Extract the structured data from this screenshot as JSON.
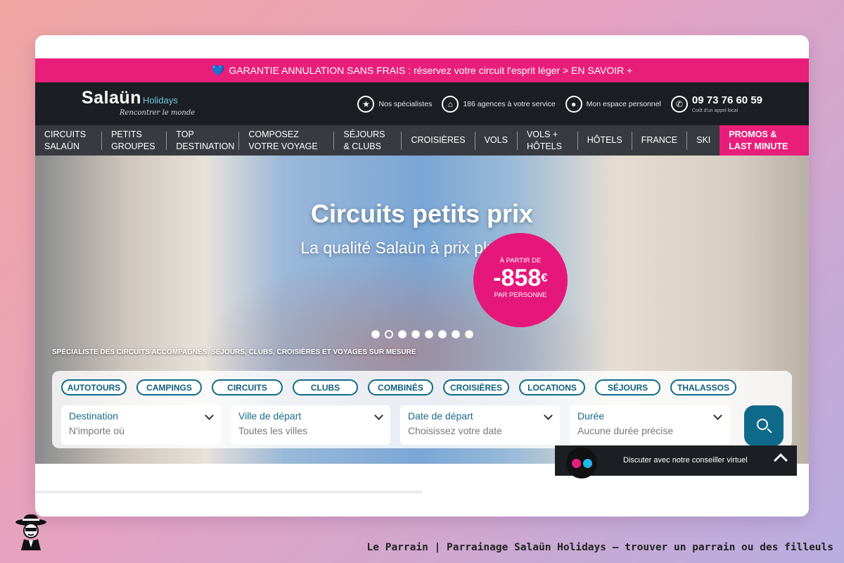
{
  "promo_banner": {
    "text": "GARANTIE ANNULATION SANS FRAIS : réservez votre circuit l'esprit léger > EN SAVOIR +"
  },
  "header": {
    "logo": {
      "name": "Salaün",
      "sub": "Holidays",
      "tagline": "Rencontrer le monde"
    },
    "links": [
      {
        "label": "Nos spécialistes",
        "icon": "star-icon"
      },
      {
        "label": "186 agences à votre service",
        "icon": "home-location-icon"
      },
      {
        "label": "Mon espace personnel",
        "icon": "user-icon"
      }
    ],
    "phone": {
      "number": "09 73 76 60 59",
      "note": "Coût d'un appel local",
      "icon": "phone-icon"
    }
  },
  "nav": {
    "items": [
      "CIRCUITS SALAÜN",
      "PETITS GROUPES",
      "TOP DESTINATION",
      "COMPOSEZ VOTRE VOYAGE",
      "SÉJOURS & CLUBS",
      "CROISIÈRES",
      "VOLS",
      "VOLS + HÔTELS",
      "HÔTELS",
      "FRANCE",
      "SKI"
    ],
    "promo": "PROMOS & LAST MINUTE",
    "promo_color": "#e91e7a"
  },
  "hero": {
    "title": "Circuits petits prix",
    "subtitle": "La qualité Salaün à prix plus doux",
    "badge": {
      "from": "À PARTIR DE",
      "price": "-858",
      "currency": "€",
      "per": "PAR PERSONNE"
    },
    "slides_count": 8,
    "active_slide": 2,
    "specialist_text": "SPÉCIALISTE DES CIRCUITS ACCOMPAGNÉS, SÉJOURS, CLUBS, CROISIÈRES ET VOYAGES SUR MESURE"
  },
  "search": {
    "categories": [
      "AUTOTOURS",
      "CAMPINGS",
      "CIRCUITS",
      "CLUBS",
      "COMBINÉS",
      "CROISIÈRES",
      "LOCATIONS",
      "SÉJOURS",
      "THALASSOS"
    ],
    "fields": [
      {
        "label": "Destination",
        "value": "N'importe où"
      },
      {
        "label": "Ville de départ",
        "value": "Toutes les villes"
      },
      {
        "label": "Date de départ",
        "value": "Choisissez votre date"
      },
      {
        "label": "Durée",
        "value": "Aucune durée précise"
      }
    ],
    "button_icon": "search-icon",
    "accent_color": "#0f6a8a"
  },
  "chat": {
    "text": "Discuter avec notre conseiller virtuel"
  },
  "footer": {
    "caption": "Le Parrain | Parrainage Salaün Holidays — trouver un parrain ou des filleuls"
  }
}
